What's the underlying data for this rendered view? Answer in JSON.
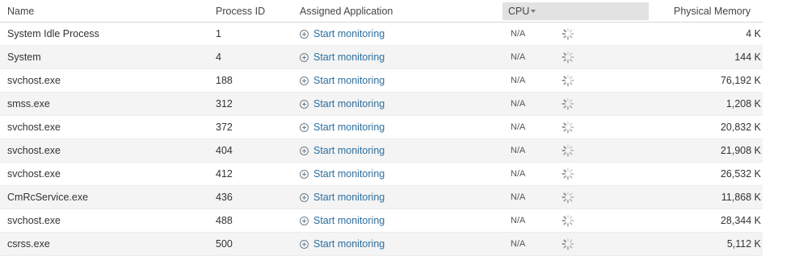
{
  "columns": {
    "name": "Name",
    "pid": "Process ID",
    "app": "Assigned Application",
    "cpu": "CPU",
    "mem": "Physical Memory"
  },
  "sort": {
    "column": "CPU",
    "direction": "descending",
    "icon": "sort-down-arrow-icon"
  },
  "link_label": "Start monitoring",
  "link_icon": "add-circle-icon",
  "loading_icon": "spinner-icon",
  "colors": {
    "link": "#2c6e9e",
    "row_alt": "#f4f4f4",
    "sorted_header": "#e2e2e2"
  },
  "rows": [
    {
      "name": "System Idle Process",
      "pid": "1",
      "cpu": "N/A",
      "mem": "4 K"
    },
    {
      "name": "System",
      "pid": "4",
      "cpu": "N/A",
      "mem": "144 K"
    },
    {
      "name": "svchost.exe",
      "pid": "188",
      "cpu": "N/A",
      "mem": "76,192 K"
    },
    {
      "name": "smss.exe",
      "pid": "312",
      "cpu": "N/A",
      "mem": "1,208 K"
    },
    {
      "name": "svchost.exe",
      "pid": "372",
      "cpu": "N/A",
      "mem": "20,832 K"
    },
    {
      "name": "svchost.exe",
      "pid": "404",
      "cpu": "N/A",
      "mem": "21,908 K"
    },
    {
      "name": "svchost.exe",
      "pid": "412",
      "cpu": "N/A",
      "mem": "26,532 K"
    },
    {
      "name": "CmRcService.exe",
      "pid": "436",
      "cpu": "N/A",
      "mem": "11,868 K"
    },
    {
      "name": "svchost.exe",
      "pid": "488",
      "cpu": "N/A",
      "mem": "28,344 K"
    },
    {
      "name": "csrss.exe",
      "pid": "500",
      "cpu": "N/A",
      "mem": "5,112 K"
    }
  ]
}
